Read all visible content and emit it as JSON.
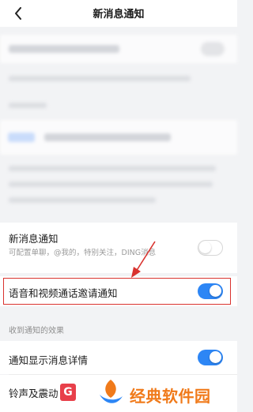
{
  "header": {
    "title": "新消息通知"
  },
  "new_message": {
    "title": "新消息通知",
    "subtitle": "可配置单聊，@我的，特别关注，DING消息",
    "enabled": false
  },
  "voice_video": {
    "title": "语音和视频通话邀请通知",
    "enabled": true
  },
  "effects": {
    "section_label": "收到通知的效果",
    "show_details": {
      "title": "通知显示消息详情",
      "enabled": true
    },
    "ringtone": {
      "title": "铃声及震动"
    }
  },
  "watermark": {
    "badge": "G",
    "brand": "经典软件园"
  },
  "colors": {
    "accent": "#2d86f5",
    "highlight_box": "#d9322e",
    "arrow": "#d9322e",
    "watermark_text": "#f07a1a"
  }
}
